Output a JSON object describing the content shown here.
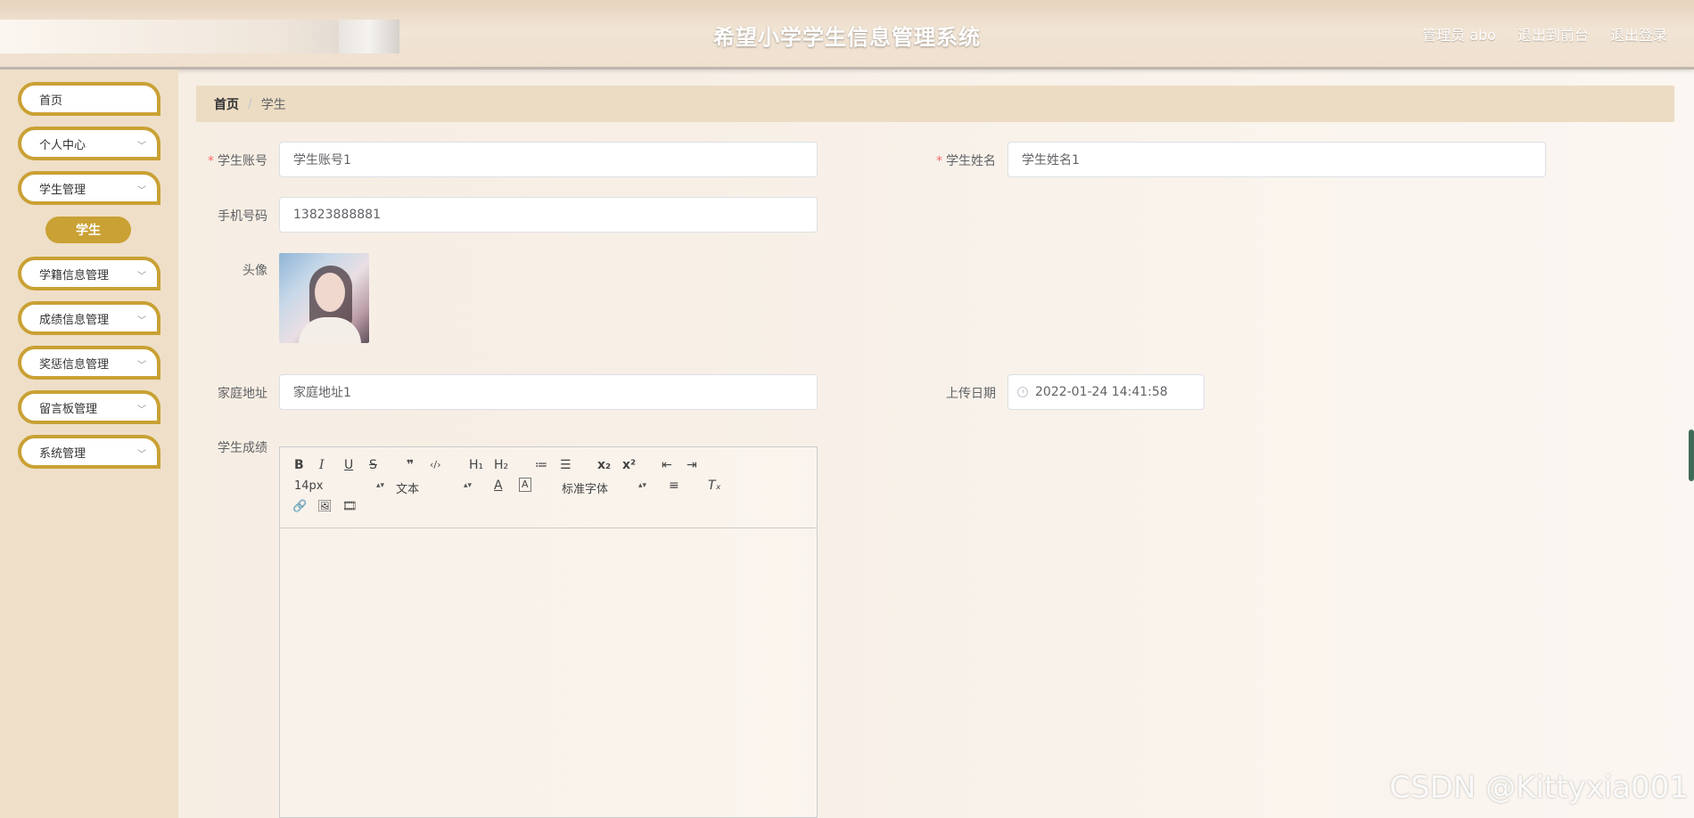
{
  "header": {
    "title": "希望小学学生信息管理系统",
    "role_user": "管理员 abo",
    "to_front": "退出到前台",
    "logout": "退出登录"
  },
  "sidebar": {
    "items": [
      {
        "label": "首页",
        "expandable": false
      },
      {
        "label": "个人中心",
        "expandable": true
      },
      {
        "label": "学生管理",
        "expandable": true
      },
      {
        "label": "学籍信息管理",
        "expandable": true
      },
      {
        "label": "成绩信息管理",
        "expandable": true
      },
      {
        "label": "奖惩信息管理",
        "expandable": true
      },
      {
        "label": "留言板管理",
        "expandable": true
      },
      {
        "label": "系统管理",
        "expandable": true
      }
    ],
    "active_sub": "学生",
    "chevron": "chevron-down-icon"
  },
  "breadcrumb": {
    "home": "首页",
    "separator": "/",
    "current": "学生"
  },
  "form": {
    "account_label": "学生账号",
    "account_value": "学生账号1",
    "name_label": "学生姓名",
    "name_value": "学生姓名1",
    "phone_label": "手机号码",
    "phone_value": "13823888881",
    "avatar_label": "头像",
    "address_label": "家庭地址",
    "address_value": "家庭地址1",
    "date_label": "上传日期",
    "date_value": "2022-01-24 14:41:58",
    "score_label": "学生成绩"
  },
  "editor": {
    "font_size": "14px",
    "header": "文本",
    "font_family": "标准字体",
    "buttons": {
      "bold": "B",
      "italic": "I",
      "underline": "U",
      "strike": "S",
      "quote": "❞",
      "code": "‹/›",
      "h1": "H₁",
      "h2": "H₂",
      "ol": "≔",
      "ul": "☰",
      "sub": "x₂",
      "sup": "x²",
      "outdent": "⇤",
      "indent": "⇥",
      "color": "A",
      "background": "A",
      "align": "≡",
      "clean": "Tₓ",
      "link": "🔗",
      "image": "🖼",
      "video": "🎞"
    }
  },
  "watermark": "CSDN @Kittyxia001",
  "colors": {
    "accent": "#c9a134",
    "sidebar": "#efdfc8",
    "breadcrumb": "#ecdcc3",
    "required": "#f56c6c"
  }
}
